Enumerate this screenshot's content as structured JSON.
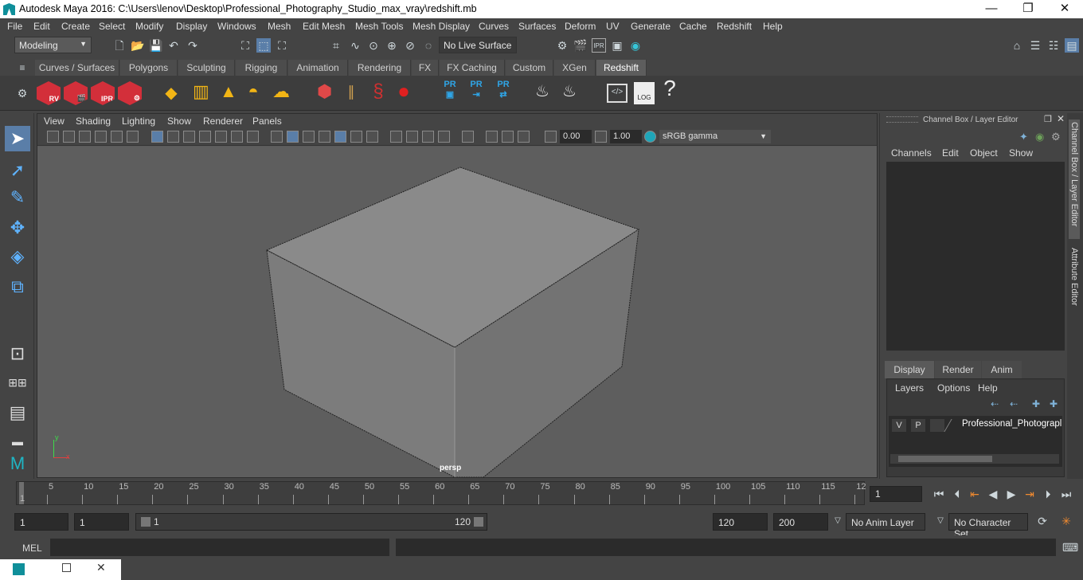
{
  "window": {
    "title": "Autodesk Maya 2016: C:\\Users\\lenov\\Desktop\\Professional_Photography_Studio_max_vray\\redshift.mb",
    "min_glyph": "—",
    "max_glyph": "❐",
    "close_glyph": "✕"
  },
  "menubar": [
    "File",
    "Edit",
    "Create",
    "Select",
    "Modify",
    "Display",
    "Windows",
    "Mesh",
    "Edit Mesh",
    "Mesh Tools",
    "Mesh Display",
    "Curves",
    "Surfaces",
    "Deform",
    "UV",
    "Generate",
    "Cache",
    "Redshift",
    "Help"
  ],
  "statusline": {
    "mode": "Modeling",
    "live_surface": "No Live Surface"
  },
  "shelf_tabs": [
    "Curves / Surfaces",
    "Polygons",
    "Sculpting",
    "Rigging",
    "Animation",
    "Rendering",
    "FX",
    "FX Caching",
    "Custom",
    "XGen",
    "Redshift"
  ],
  "active_shelf": "Redshift",
  "shelf_icons": {
    "rv": "RV",
    "ipr": "IPR",
    "pr": "PR",
    "log": "LOG",
    "help": "?"
  },
  "viewport": {
    "menu": [
      "View",
      "Shading",
      "Lighting",
      "Show",
      "Renderer",
      "Panels"
    ],
    "exposure": "0.00",
    "gamma": "1.00",
    "colorspace": "sRGB gamma",
    "camera_label": "persp",
    "axis_y": "y",
    "axis_x": "x"
  },
  "channel_box": {
    "title": "Channel Box / Layer Editor",
    "menu": [
      "Channels",
      "Edit",
      "Object",
      "Show"
    ],
    "layer_tabs": [
      "Display",
      "Render",
      "Anim"
    ],
    "layer_menu": [
      "Layers",
      "Options",
      "Help"
    ],
    "layer": {
      "v": "V",
      "p": "P",
      "name": "Professional_Photograpl"
    }
  },
  "side_tabs": {
    "channel_box": "Channel Box / Layer Editor",
    "attribute_editor": "Attribute Editor"
  },
  "timeline": {
    "ticks": [
      "5",
      "10",
      "15",
      "20",
      "25",
      "30",
      "35",
      "40",
      "45",
      "50",
      "55",
      "60",
      "65",
      "70",
      "75",
      "80",
      "85",
      "90",
      "95",
      "100",
      "105",
      "110",
      "115",
      "12"
    ],
    "start_mark": "1",
    "current_frame": "1"
  },
  "range": {
    "start": "1",
    "anim_start": "1",
    "range_start": "1",
    "range_end": "120",
    "end": "120",
    "anim_end": "200",
    "anim_layer": "No Anim Layer",
    "character_set": "No Character Set"
  },
  "command": {
    "label": "MEL"
  },
  "colors": {
    "accent_blue": "#5fb3ff",
    "redshift_red": "#d32f3a",
    "maya_teal": "#0f8f9a"
  }
}
